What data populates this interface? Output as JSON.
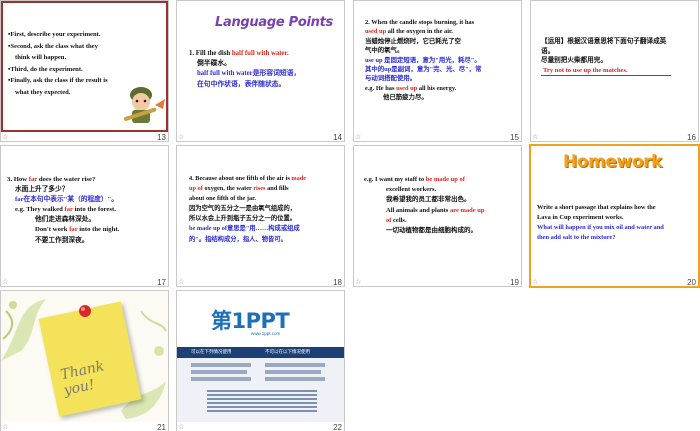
{
  "slides": [
    {
      "number": "13",
      "lines": [
        "First, describe your experiment.",
        "Second, ask the class what  they",
        "think will happen.",
        "Third, do  the experiment.",
        "Finally, ask the class if the result is",
        "what  they expected."
      ]
    },
    {
      "number": "14",
      "heading": "Language Points",
      "lines": [
        "1. Fill the dish half full with water.",
        "倒半碟水。",
        "half full with water是形容词短语，",
        "在句中作状语，表伴随状态。"
      ]
    },
    {
      "number": "15",
      "lines": [
        "2. When the candle stops burning, it has",
        "used up all the oxygen  in the air.",
        "当蜡烛停止燃烧时，它已耗光了空",
        "气中的氧气。",
        "use up 是固定短语，意为\"用光，耗尽\"。",
        "其中的up是副词，意为\"完、光、尽\"，常",
        "与动词搭配使用。",
        "e.g. He has used up all his energy.",
        "他已筋疲力尽。"
      ]
    },
    {
      "number": "16",
      "lines": [
        "【运用】根据汉语意思将下面句子翻译成英",
        "语。",
        "尽量别把火柴都用完。",
        "Try not to use up the matches."
      ]
    },
    {
      "number": "17",
      "lines": [
        "3. How  far does the water rise?",
        "水面上升了多少？",
        "far在本句中表示\"某（的程度）\"。",
        "e.g. They walked far into the forest.",
        "他们走进森林深处。",
        "Don't work far into the night.",
        "不要工作到深夜。"
      ]
    },
    {
      "number": "18",
      "lines": [
        "4. Because about  one fifth of the air is made",
        "up of oxygen,  the water rises and fills",
        "about  one fifth of the jar.",
        "因为空气的五分之一是由氧气组成的，",
        "所以水会上升到瓶子五分之一的位置。",
        "be made up of意思是\"用……构成或组成",
        "的\"。指结构成分，指人、物皆可。"
      ]
    },
    {
      "number": "19",
      "lines": [
        "e.g. I want  my staff to be made  up of",
        "excellent workers.",
        "我希望我的员工都非常出色。",
        "All animals and plants are made up",
        "of cells.",
        "一切动植物都是由细胞构成的。"
      ]
    },
    {
      "number": "20",
      "heading": "Homework",
      "lines": [
        "Write a short passage that explains how  the",
        "Lava  in Cup experiment works.",
        "What will happen  if you mix oil and water and",
        "then add  salt to the mixture?"
      ]
    },
    {
      "number": "21",
      "note": "Thank you!"
    },
    {
      "number": "22",
      "brand": "第1PPT",
      "site": "www.1ppt.com",
      "panel": {
        "left": "可以在下列情况使用",
        "right": "不可以在以下情况使用"
      }
    }
  ],
  "colors": {
    "red": "#e2231a",
    "blue": "#2b2bd6",
    "homework": "#f0a21e",
    "brand": "#1d6fb8"
  }
}
